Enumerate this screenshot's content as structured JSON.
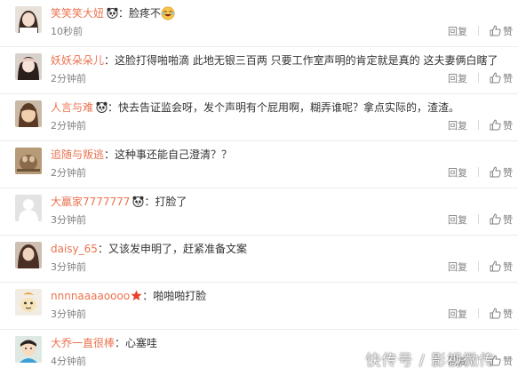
{
  "comments": [
    {
      "username": "笑笑笑大妞",
      "badge": "panda-icon",
      "text": "脸疼不",
      "trailing_emoji": "laugh-emoji-icon",
      "time": "10秒前",
      "reply_label": "回复",
      "like_label": "赞"
    },
    {
      "username": "妖妖朵朵儿",
      "badge": "",
      "text": "这脸打得啪啪滴 此地无银三百两 只要工作室声明的肯定就是真的 这夫妻俩白瞎了",
      "time": "2分钟前",
      "reply_label": "回复",
      "like_label": "赞"
    },
    {
      "username": "人言与难",
      "badge": "panda-icon",
      "text": "快去告证监会呀，发个声明有个屁用啊，糊弄谁呢？拿点实际的，渣渣。",
      "time": "2分钟前",
      "reply_label": "回复",
      "like_label": "赞"
    },
    {
      "username": "追随与叛逃",
      "badge": "",
      "text": "这种事还能自己澄清？？",
      "time": "2分钟前",
      "reply_label": "回复",
      "like_label": "赞"
    },
    {
      "username": "大羸家7777777",
      "badge": "panda-icon",
      "text": "打脸了",
      "time": "3分钟前",
      "reply_label": "回复",
      "like_label": "赞"
    },
    {
      "username": "daisy_65",
      "badge": "",
      "text": "又该发申明了，赶紧准备文案",
      "time": "3分钟前",
      "reply_label": "回复",
      "like_label": "赞"
    },
    {
      "username": "nnnnaaaaoooo",
      "badge": "star-icon",
      "text": "啪啪啪打脸",
      "time": "3分钟前",
      "reply_label": "回复",
      "like_label": "赞"
    },
    {
      "username": "大乔一直很棒",
      "badge": "",
      "text": "心塞哇",
      "time": "4分钟前",
      "reply_label": "回复",
      "like_label": "赞"
    }
  ],
  "watermark": "快传号 / 影视微传",
  "colors": {
    "username": "#eb7350",
    "text": "#333333",
    "meta": "#808080",
    "divider": "#ececec"
  }
}
